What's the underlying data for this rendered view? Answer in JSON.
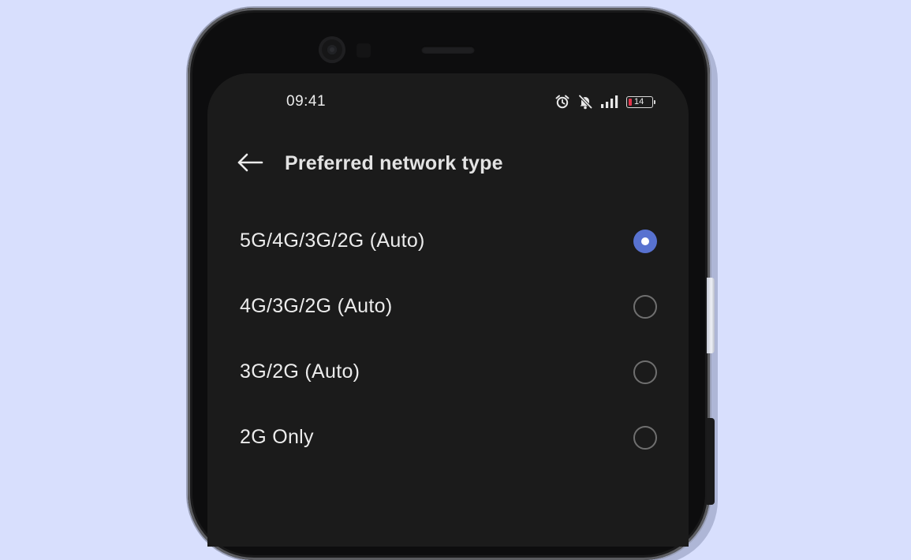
{
  "status_bar": {
    "time": "09:41",
    "battery_level": "14",
    "icons": [
      "alarm-icon",
      "bell-off-icon",
      "signal-icon",
      "battery-icon"
    ]
  },
  "header": {
    "back_icon": "arrow-left-icon",
    "title": "Preferred network type"
  },
  "options": [
    {
      "label": "5G/4G/3G/2G (Auto)",
      "selected": true
    },
    {
      "label": "4G/3G/2G (Auto)",
      "selected": false
    },
    {
      "label": "3G/2G (Auto)",
      "selected": false
    },
    {
      "label": "2G Only",
      "selected": false
    }
  ],
  "colors": {
    "page_background": "#d8dffd",
    "screen_background": "#1b1b1b",
    "accent": "#5872d0",
    "battery_low": "#e3344a"
  }
}
